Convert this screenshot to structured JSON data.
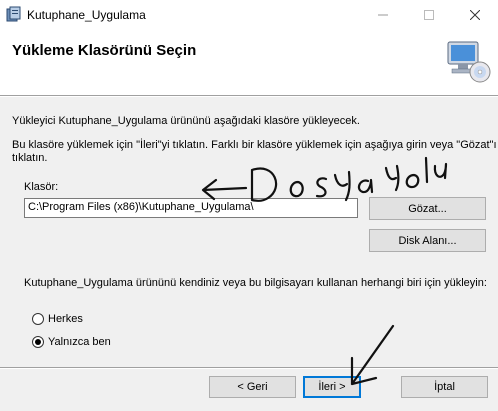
{
  "window": {
    "title": "Kutuphane_Uygulama"
  },
  "header": {
    "title": "Yükleme Klasörünü Seçin"
  },
  "body": {
    "intro": "Yükleyici Kutuphane_Uygulama ürününü aşağıdaki klasöre yükleyecek.",
    "instructions_line1": "Bu klasöre yüklemek için \"İleri\"yi tıklatın. Farklı bir klasöre yüklemek için aşağıya girin veya \"Gözat\"ı",
    "instructions_line2": "tıklatın.",
    "folder_label": "Klasör:",
    "folder_value": "C:\\Program Files (x86)\\Kutuphane_Uygulama\\",
    "browse_label": "Gözat...",
    "disk_label": "Disk Alanı...",
    "install_for_text": "Kutuphane_Uygulama ürününü kendiniz veya bu bilgisayarı kullanan herhangi biri için yükleyin:",
    "radio_everyone": "Herkes",
    "radio_just_me": "Yalnızca ben",
    "selected_option": "Yalnızca ben"
  },
  "footer": {
    "back_label": "< Geri",
    "next_label": "İleri >",
    "cancel_label": "İptal"
  },
  "annotation": {
    "handwriting": "Dosya yolu"
  }
}
